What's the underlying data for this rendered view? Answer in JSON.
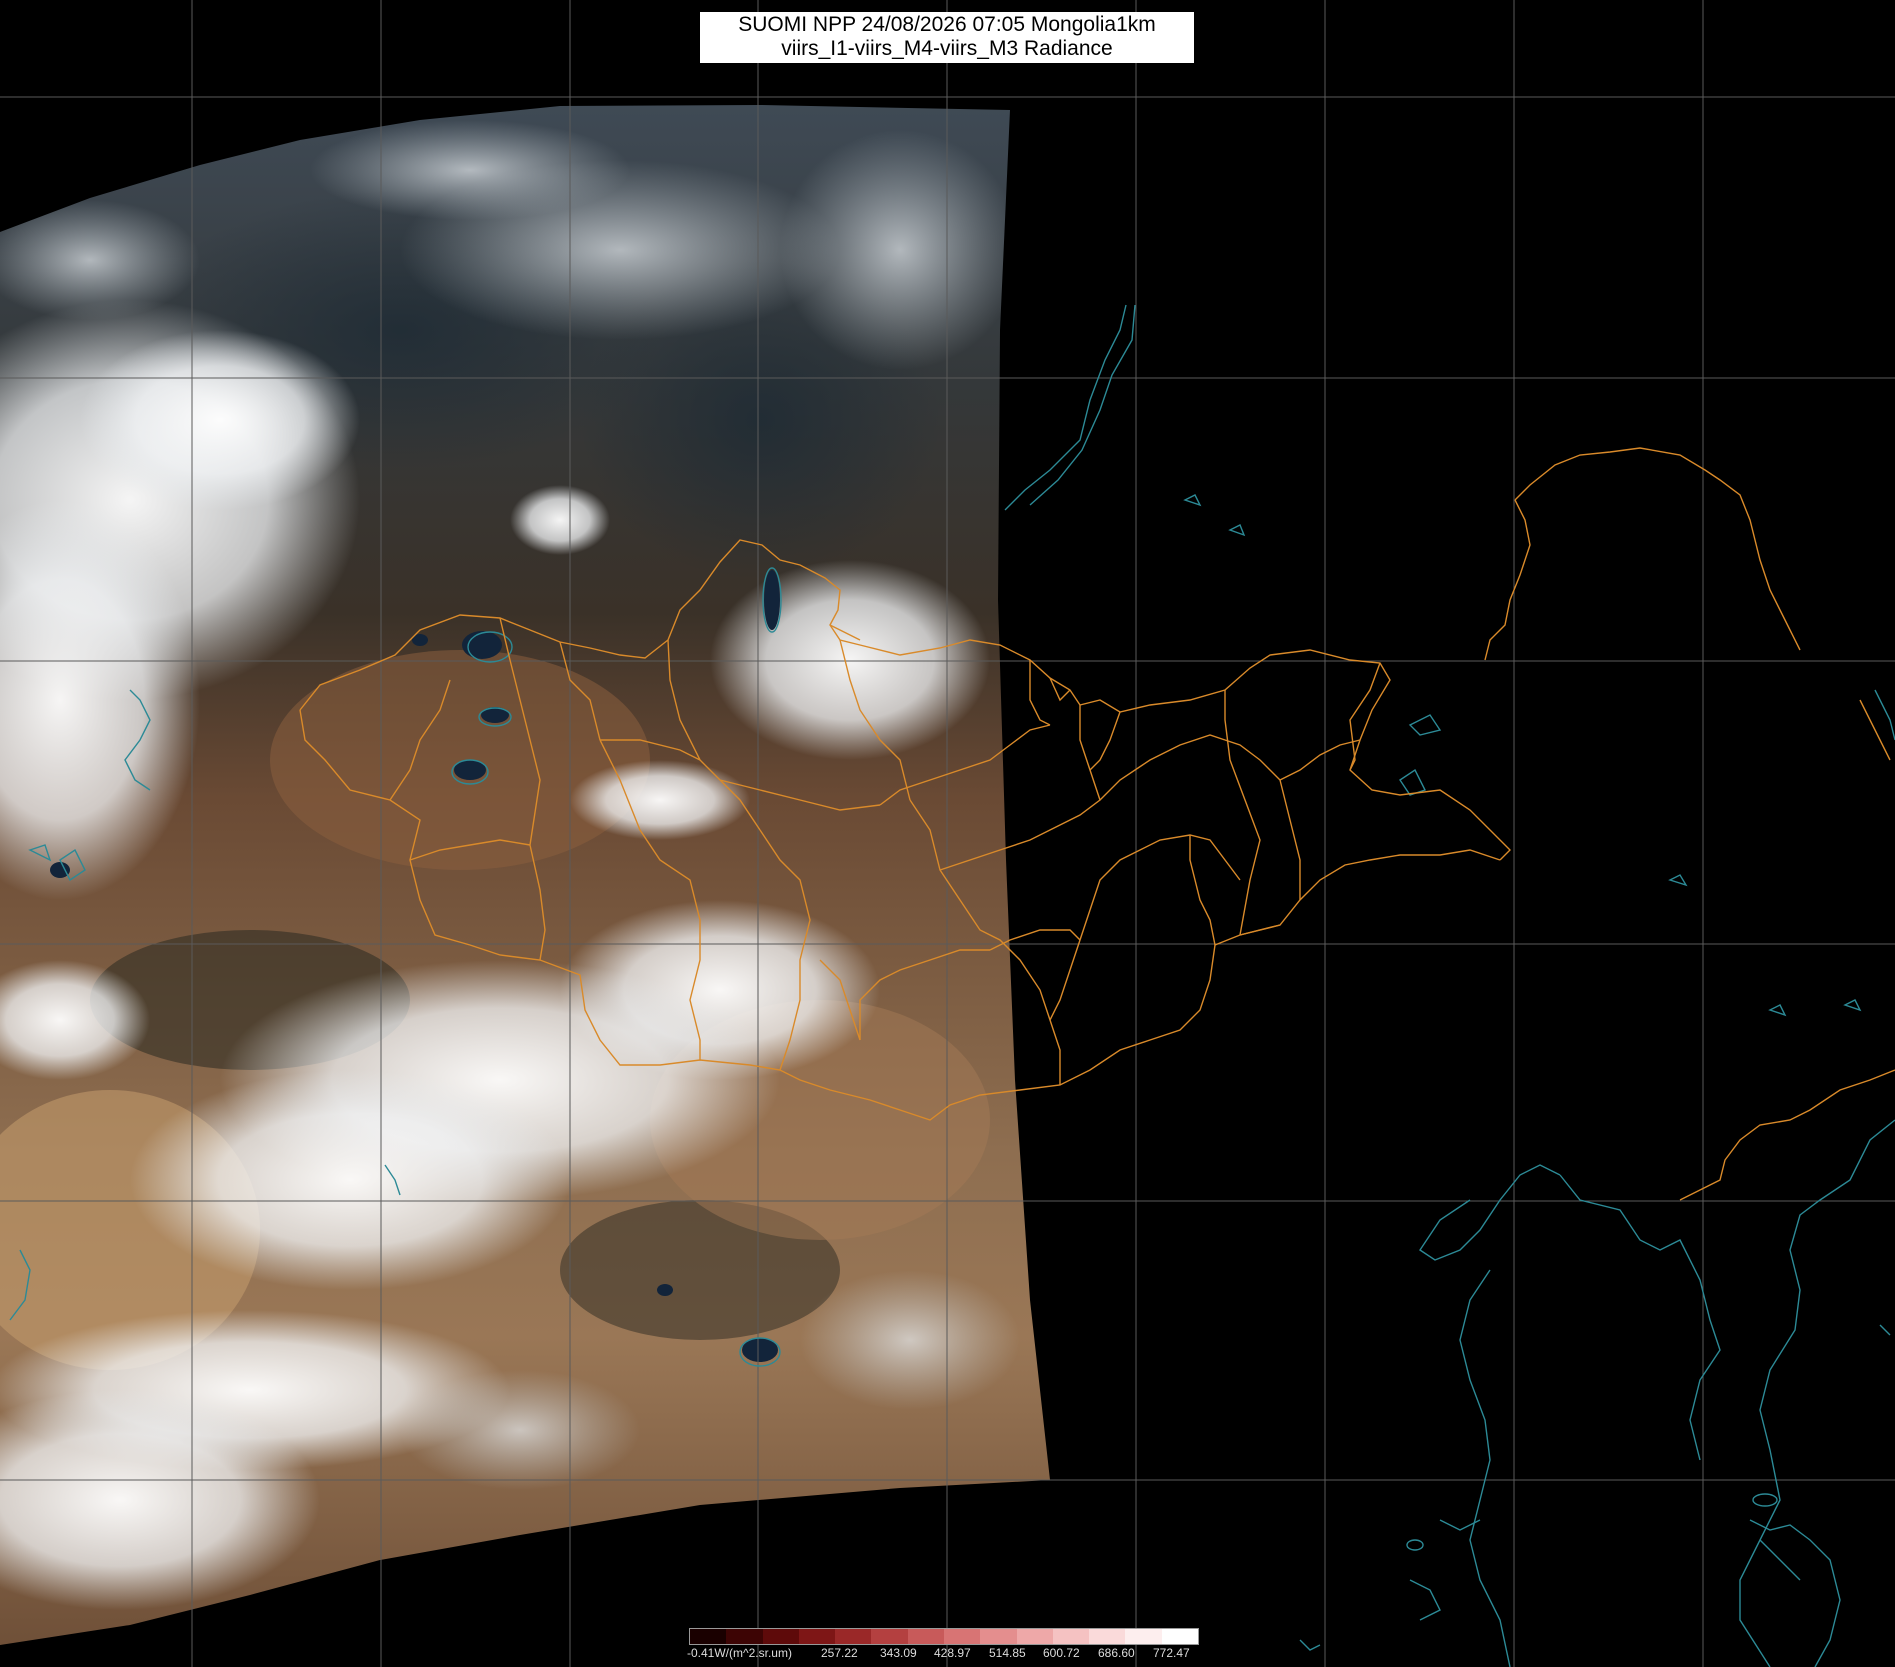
{
  "title": {
    "line1": "SUOMI NPP 24/08/2026 07:05 Mongolia1km",
    "line2": "viirs_I1-viirs_M4-viirs_M3 Radiance"
  },
  "legend": {
    "labels": [
      "-0.41W/(m^2.sr.um)",
      "257.22",
      "343.09",
      "428.97",
      "514.85",
      "600.72",
      "686.60",
      "772.47"
    ],
    "colors": [
      "#1a0000",
      "#3d0404",
      "#5e0a0a",
      "#7e1616",
      "#9a2828",
      "#b44040",
      "#c85a5a",
      "#d87474",
      "#e48e8e",
      "#eea8a8",
      "#f5c2c2",
      "#fadada",
      "#fdeeee",
      "#ffffff"
    ]
  },
  "colors": {
    "border_line": "#d98a2a",
    "coast_line": "#2c8a96",
    "graticule": "#5a5a5a",
    "background": "#000000"
  },
  "map": {
    "swath": "satellite-image",
    "clouds": "cloud-cover",
    "country_borders": "mongolia-province-borders",
    "coastlines": "coastlines",
    "lakes": "lakes"
  }
}
